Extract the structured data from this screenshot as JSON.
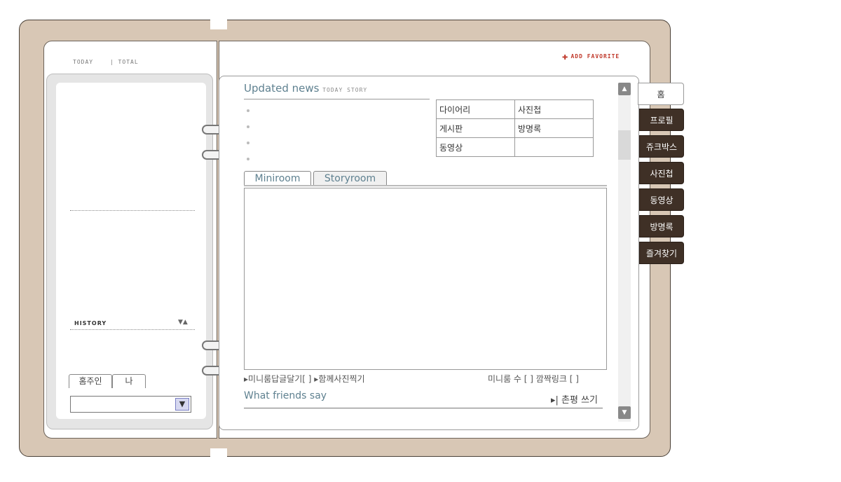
{
  "header": {
    "today_label": "TODAY",
    "total_label": "| TOTAL",
    "add_favorite": "ADD FAVORITE",
    "add_icon": "plus-icon"
  },
  "left": {
    "history_label": "HISTORY",
    "history_arrows": "▼▲",
    "owner_tabs": [
      "홈주인",
      "나"
    ]
  },
  "news": {
    "title": "Updated news",
    "subtitle": "TODAY STORY"
  },
  "menu_table": [
    [
      "다이어리",
      "사진첩"
    ],
    [
      "게시판",
      "방명록"
    ],
    [
      "동영상",
      ""
    ]
  ],
  "room_tabs": [
    "Miniroom",
    "Storyroom"
  ],
  "actions": {
    "left": "▸미니룸답글달기[   ] ▸함께사진찍기",
    "right": "미니룸 수 [  ]  깜짝링크 [ ]"
  },
  "friends": {
    "title": "What friends say",
    "write": "▸| 촌평 쓰기"
  },
  "nav": [
    "홈",
    "프로필",
    "쥬크박스",
    "사진첩",
    "동영상",
    "방명록",
    "즐겨찾기"
  ],
  "scroll": {
    "up": "▲",
    "down": "▼"
  },
  "colors": {
    "cover": "#d8c7b5",
    "nav_dark": "#3f3026",
    "accent_text": "#5f8190",
    "favorite": "#c0392b"
  }
}
